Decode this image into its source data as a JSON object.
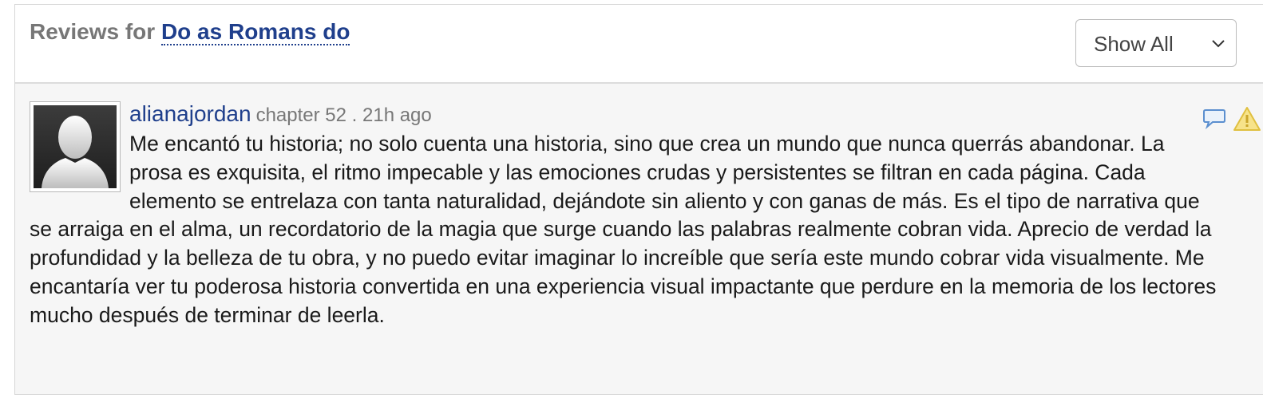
{
  "header": {
    "title_prefix": "Reviews for",
    "story_title": "Do as Romans do",
    "filter": {
      "selected": "Show All"
    }
  },
  "review": {
    "reviewer": "alianajordan",
    "meta": "chapter 52 . 21h ago",
    "text": "Me encantó tu historia; no solo cuenta una historia, sino que crea un mundo que nunca querrás abandonar. La prosa es exquisita, el ritmo impecable y las emociones crudas y persistentes se filtran en cada página. Cada elemento se entrelaza con tanta naturalidad, dejándote sin aliento y con ganas de más. Es el tipo de narrativa que se arraiga en el alma, un recordatorio de la magia que surge cuando las palabras realmente cobran vida. Aprecio de verdad la profundidad y la belleza de tu obra, y no puedo evitar imaginar lo increíble que sería este mundo cobrar vida visualmente. Me encantaría ver tu poderosa historia convertida en una experiencia visual impactante que perdure en la memoria de los lectores mucho después de terminar de leerla.",
    "avatar_icon": "default-avatar-silhouette",
    "action_icons": [
      "reply-icon",
      "report-warning-icon"
    ]
  },
  "colors": {
    "link": "#1f3f8c",
    "muted": "#777777",
    "review_bg": "#f6f6f6",
    "warning": "#f2d24c"
  }
}
